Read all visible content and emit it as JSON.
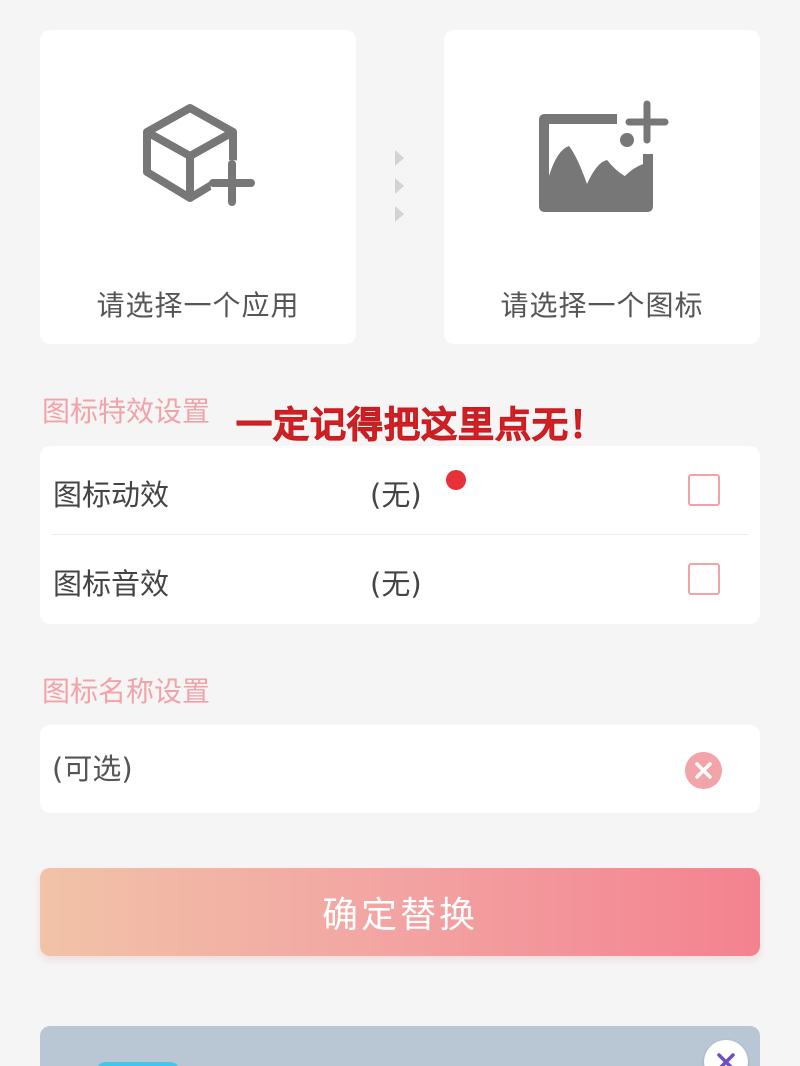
{
  "picker": {
    "app": {
      "label": "请选择一个应用",
      "icon": "cube-plus-icon"
    },
    "icon": {
      "label": "请选择一个图标",
      "icon": "image-plus-icon"
    },
    "connector_icon": "chevron-right-triple-icon"
  },
  "effects": {
    "title": "图标特效设置",
    "annotation": "一定记得把这里点无！",
    "rows": [
      {
        "name": "图标动效",
        "value": "(无)",
        "checked": false
      },
      {
        "name": "图标音效",
        "value": "(无)",
        "checked": false
      }
    ]
  },
  "name_settings": {
    "title": "图标名称设置",
    "placeholder": "(可选)",
    "value": ""
  },
  "confirm": {
    "label": "确定替换"
  },
  "colors": {
    "accent": "#f1a3a8",
    "annotation": "#e2262a",
    "gradient_start": "#f1c3a7",
    "gradient_end": "#f3828f",
    "background": "#f6f5f6"
  }
}
